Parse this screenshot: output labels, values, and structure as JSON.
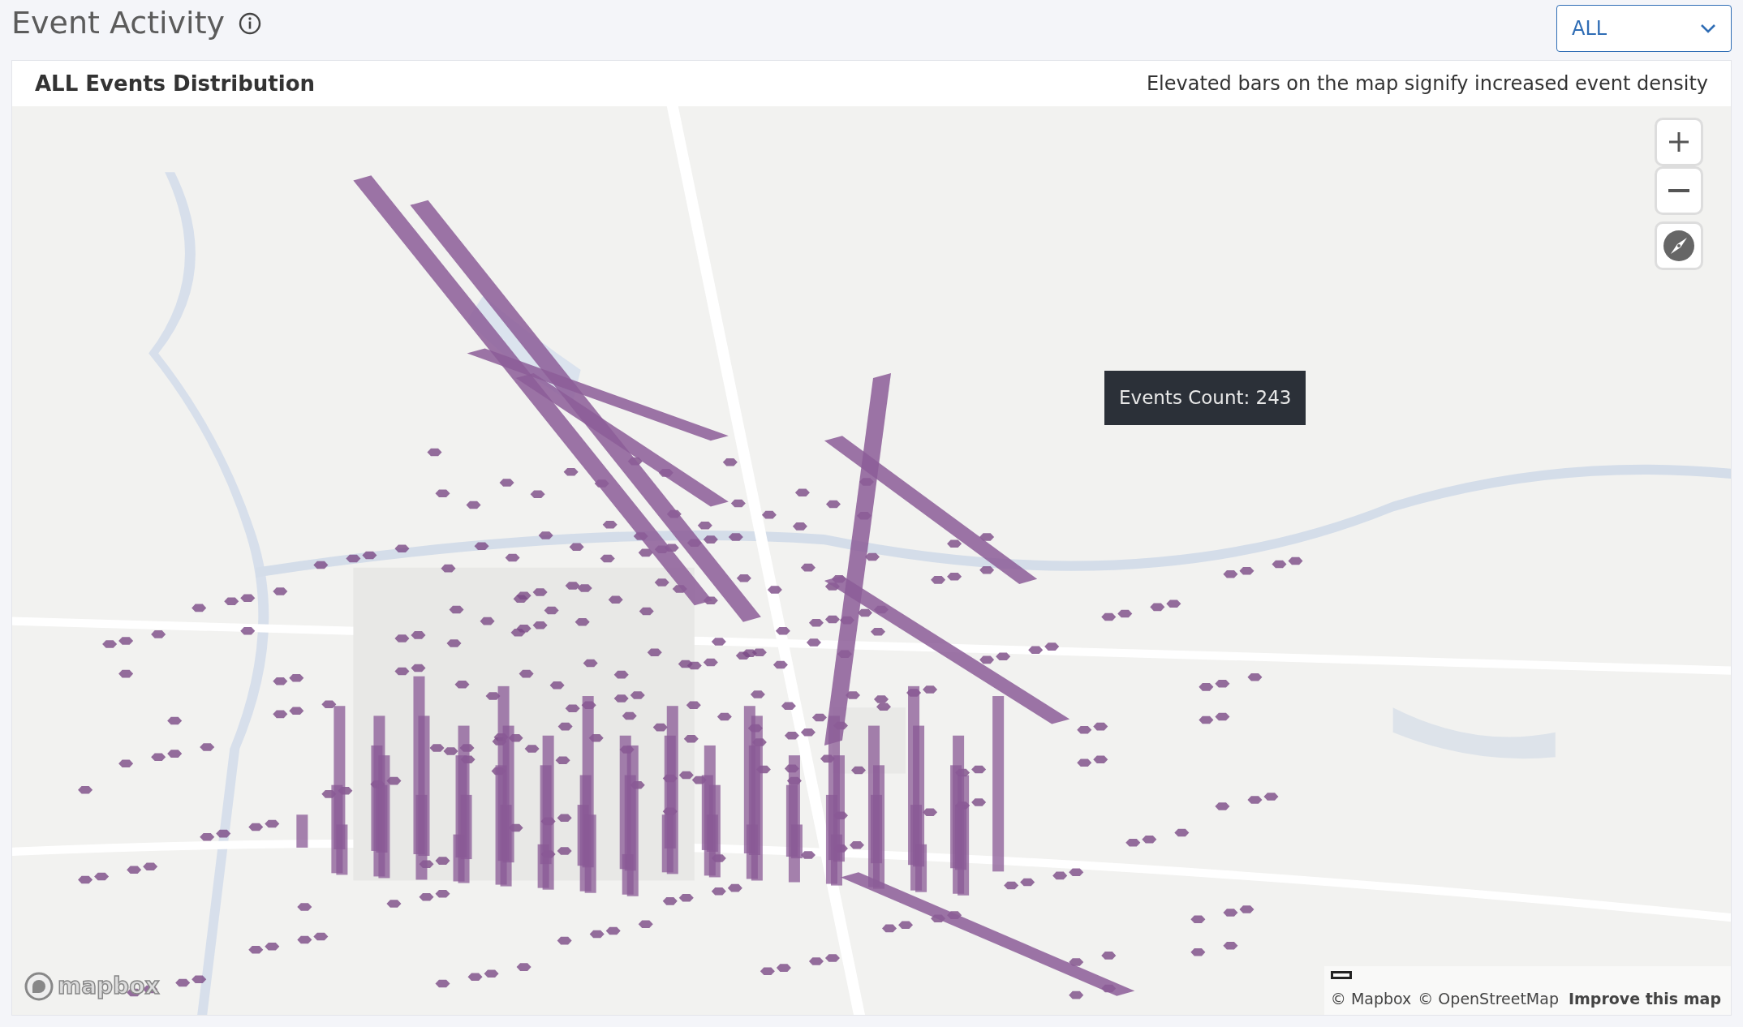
{
  "header": {
    "title": "Event Activity",
    "filter": {
      "value": "ALL"
    }
  },
  "card": {
    "title": "ALL Events Distribution",
    "subtitle": "Elevated bars on the map signify increased event density",
    "map": {
      "kind": "picture",
      "tooltip": "Events Count: 243",
      "logo": "mapbox",
      "attribution": [
        {
          "text": "© Mapbox",
          "kind": "link"
        },
        {
          "text": "© OpenStreetMap",
          "kind": "link"
        },
        {
          "text": "Improve this map",
          "kind": "strong"
        }
      ]
    }
  }
}
